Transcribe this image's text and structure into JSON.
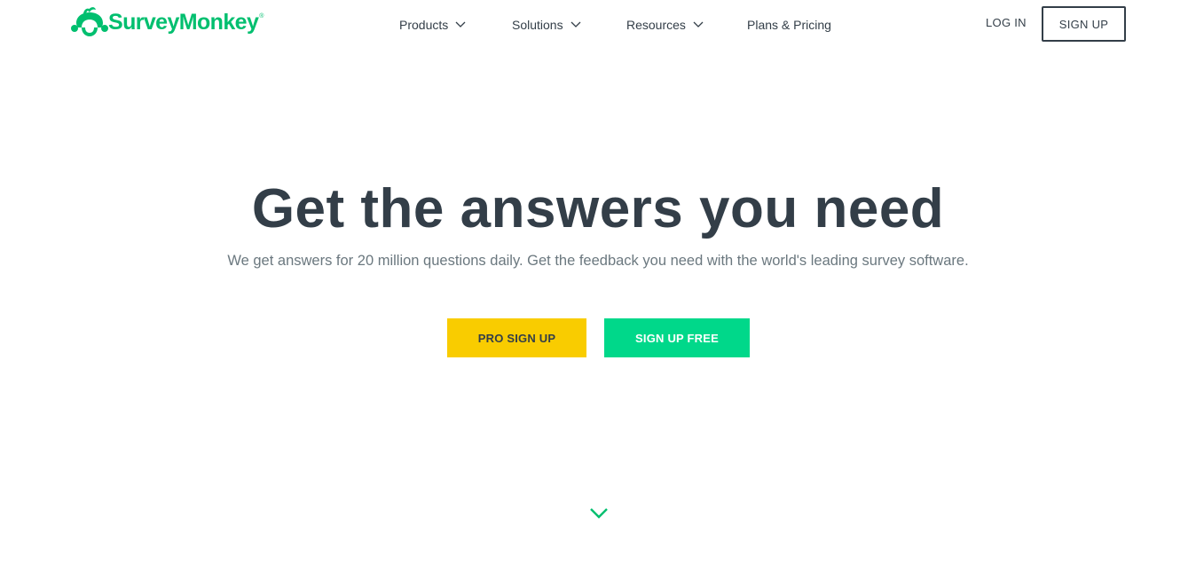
{
  "brand": {
    "name": "SurveyMonkey",
    "registered_mark": "®",
    "logo_icon": "monkey-logo-icon",
    "color": "#00bf6f"
  },
  "nav": {
    "items": [
      {
        "label": "Products",
        "has_dropdown": true
      },
      {
        "label": "Solutions",
        "has_dropdown": true
      },
      {
        "label": "Resources",
        "has_dropdown": true
      },
      {
        "label": "Plans & Pricing",
        "has_dropdown": false
      }
    ],
    "login_label": "LOG IN",
    "signup_label": "SIGN UP"
  },
  "hero": {
    "title": "Get the answers you need",
    "subtitle": "We get answers for 20 million questions daily. Get the feedback you need with the world's leading survey software.",
    "pro_button_label": "PRO SIGN UP",
    "free_button_label": "SIGN UP FREE",
    "scroll_icon": "chevron-down-icon"
  },
  "colors": {
    "text_dark": "#333e48",
    "text_muted": "#6b787f",
    "pro_yellow": "#f9cc00",
    "free_green": "#00d88a",
    "accent_teal": "#00bf6f"
  }
}
